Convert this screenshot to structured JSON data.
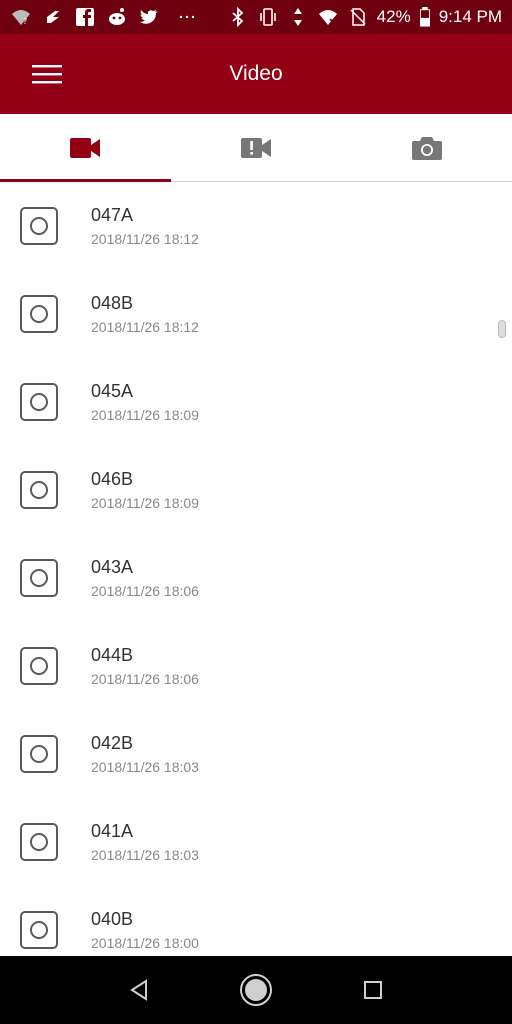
{
  "status": {
    "battery": "42%",
    "time": "9:14 PM",
    "left_icons": [
      "wifi-question-icon",
      "nfc-icon",
      "facebook-icon",
      "reddit-icon",
      "twitter-icon",
      "more-dots-icon"
    ],
    "right_icons": [
      "bluetooth-icon",
      "vibrate-icon",
      "data-arrows-icon",
      "wifi-x-icon",
      "no-sim-icon",
      "battery-icon"
    ]
  },
  "app_bar": {
    "title": "Video"
  },
  "tabs": [
    {
      "name": "video",
      "icon": "video-camera-icon",
      "active": true
    },
    {
      "name": "event",
      "icon": "video-alert-icon",
      "active": false
    },
    {
      "name": "photo",
      "icon": "camera-icon",
      "active": false
    }
  ],
  "files": [
    {
      "name": "047A",
      "date": "2018/11/26 18:12"
    },
    {
      "name": "048B",
      "date": "2018/11/26 18:12"
    },
    {
      "name": "045A",
      "date": "2018/11/26 18:09"
    },
    {
      "name": "046B",
      "date": "2018/11/26 18:09"
    },
    {
      "name": "043A",
      "date": "2018/11/26 18:06"
    },
    {
      "name": "044B",
      "date": "2018/11/26 18:06"
    },
    {
      "name": "042B",
      "date": "2018/11/26 18:03"
    },
    {
      "name": "041A",
      "date": "2018/11/26 18:03"
    },
    {
      "name": "040B",
      "date": "2018/11/26 18:00"
    }
  ],
  "colors": {
    "status_bar": "#6e0010",
    "app_bar": "#930016",
    "accent": "#930016"
  }
}
